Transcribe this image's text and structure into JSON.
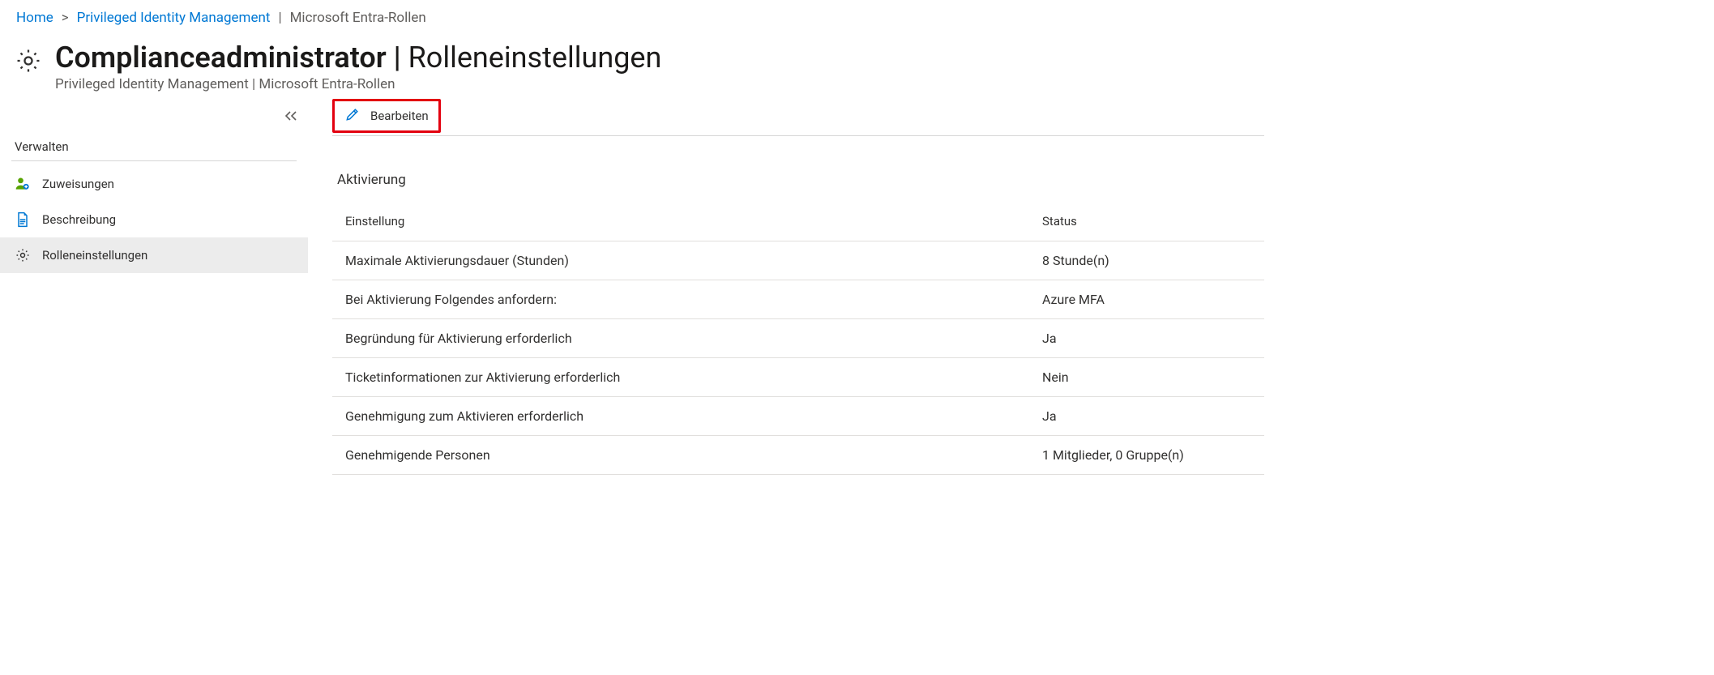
{
  "breadcrumb": {
    "home": "Home",
    "pim": "Privileged Identity Management",
    "tail": "Microsoft Entra-Rollen"
  },
  "header": {
    "title_left": "Complianceadministrator",
    "title_right": "Rolleneinstellungen",
    "subtitle_left": "Privileged Identity Management",
    "subtitle_right": "Microsoft Entra-Rollen"
  },
  "sidebar": {
    "section_label": "Verwalten",
    "items": [
      {
        "label": "Zuweisungen"
      },
      {
        "label": "Beschreibung"
      },
      {
        "label": "Rolleneinstellungen"
      }
    ]
  },
  "toolbar": {
    "edit_label": "Bearbeiten"
  },
  "activation": {
    "section_title": "Aktivierung",
    "columns": {
      "setting": "Einstellung",
      "status": "Status"
    },
    "rows": [
      {
        "setting": "Maximale Aktivierungsdauer (Stunden)",
        "status": "8 Stunde(n)"
      },
      {
        "setting": "Bei Aktivierung Folgendes anfordern:",
        "status": "Azure MFA"
      },
      {
        "setting": "Begründung für Aktivierung erforderlich",
        "status": "Ja"
      },
      {
        "setting": "Ticketinformationen zur Aktivierung erforderlich",
        "status": "Nein"
      },
      {
        "setting": "Genehmigung zum Aktivieren erforderlich",
        "status": "Ja"
      },
      {
        "setting": "Genehmigende Personen",
        "status": "1 Mitglieder, 0 Gruppe(n)",
        "is_link": true
      }
    ]
  }
}
